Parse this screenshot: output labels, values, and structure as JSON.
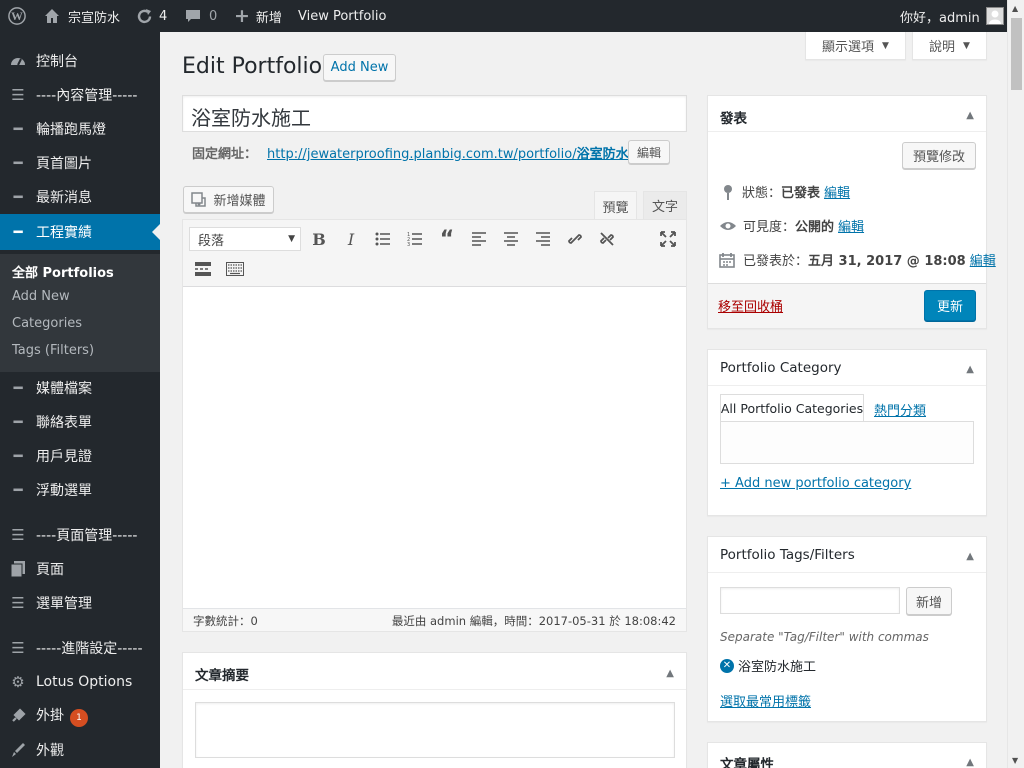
{
  "adminbar": {
    "site_name": "宗宣防水",
    "updates_count": "4",
    "comments_count": "0",
    "new_label": "新增",
    "view_label": "View Portfolio",
    "greeting": "你好，admin"
  },
  "sidebar": {
    "items": [
      {
        "label": "控制台",
        "icon": "dashboard-icon"
      },
      {
        "label": "----內容管理-----",
        "icon": "menu-icon"
      },
      {
        "label": "輪播跑馬燈",
        "icon": "dash-icon"
      },
      {
        "label": "頁首圖片",
        "icon": "dash-icon"
      },
      {
        "label": "最新消息",
        "icon": "dash-icon"
      },
      {
        "label": "工程實績",
        "icon": "dash-icon"
      },
      {
        "label": "媒體檔案",
        "icon": "dash-icon"
      },
      {
        "label": "聯絡表單",
        "icon": "dash-icon"
      },
      {
        "label": "用戶見證",
        "icon": "dash-icon"
      },
      {
        "label": "浮動選單",
        "icon": "dash-icon"
      },
      {
        "label": "----頁面管理-----",
        "icon": "menu-icon"
      },
      {
        "label": "頁面",
        "icon": "pages-icon"
      },
      {
        "label": "選單管理",
        "icon": "menu-icon"
      },
      {
        "label": "-----進階設定-----",
        "icon": "menu-icon"
      },
      {
        "label": "Lotus Options",
        "icon": "gear-icon"
      },
      {
        "label": "外掛",
        "icon": "plugin-icon"
      },
      {
        "label": "外觀",
        "icon": "brush-icon"
      }
    ],
    "plugin_badge": "1",
    "submenu": [
      "全部 Portfolios",
      "Add New",
      "Categories",
      "Tags (Filters)"
    ]
  },
  "screen_options_label": "顯示選項",
  "help_label": "說明",
  "page_title": "Edit Portfolio",
  "add_new_label": "Add New",
  "post_title": "浴室防水施工",
  "permalink": {
    "label": "固定網址：",
    "url_prefix": "http://jewaterproofing.planbig.com.tw/portfolio/",
    "slug": "浴室防水施工",
    "url_suffix": "/",
    "edit_label": "編輯"
  },
  "editor": {
    "add_media_label": "新增媒體",
    "tab_visual": "預覽",
    "tab_text": "文字",
    "format_select": "段落",
    "word_count": "字數統計：0",
    "last_edited": "最近由 admin 編輯，時間：2017-05-31 於 18:08:42"
  },
  "excerpt": {
    "title": "文章摘要"
  },
  "publish": {
    "title": "發表",
    "preview_label": "預覽修改",
    "status_label": "狀態：",
    "status_value": "已發表",
    "visibility_label": "可見度：",
    "visibility_value": "公開的",
    "published_label": "已發表於：",
    "published_value": "五月 31, 2017 @ 18:08",
    "edit_link": "編輯",
    "trash_label": "移至回收桶",
    "update_label": "更新"
  },
  "category_box": {
    "title": "Portfolio Category",
    "tab_all": "All Portfolio Categories",
    "tab_popular": "熱門分類",
    "add_link": "+ Add new portfolio category"
  },
  "tags_box": {
    "title": "Portfolio Tags/Filters",
    "input_value": "",
    "add_label": "新增",
    "hint": "Separate \"Tag/Filter\" with commas",
    "tag": "浴室防水施工",
    "choose_link": "選取最常用標籤"
  },
  "attributes_box": {
    "title": "文章屬性"
  },
  "colors": {
    "accent": "#0073aa",
    "adminbar": "#23282d",
    "badge": "#d54e21",
    "trash": "#a00"
  }
}
